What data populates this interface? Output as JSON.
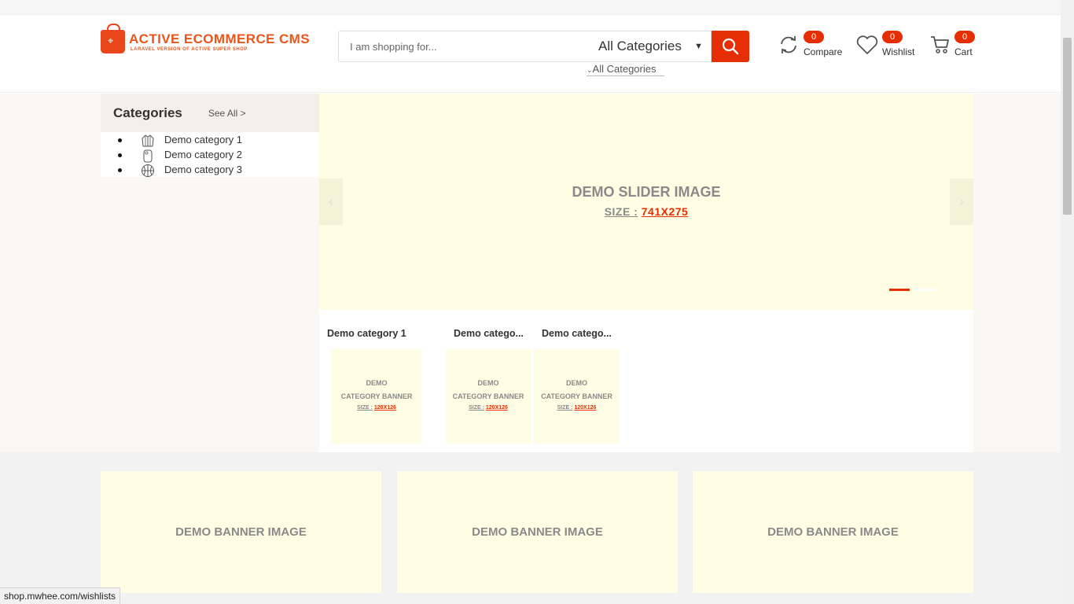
{
  "logo": {
    "title": "ACTIVE ECOMMERCE CMS",
    "tagline": "LARAVEL VERSION OF ACTIVE SUPER SHOP"
  },
  "search": {
    "placeholder": "I am shopping for...",
    "category_selected": "All Categories",
    "dropdown_option": "All Categories"
  },
  "header": {
    "compare": {
      "label": "Compare",
      "count": "0"
    },
    "wishlist": {
      "label": "Wishlist",
      "count": "0"
    },
    "cart": {
      "label": "Cart",
      "count": "0"
    }
  },
  "categories": {
    "heading": "Categories",
    "see_all": "See All >",
    "items": [
      {
        "label": "Demo category 1",
        "icon": "jacket-icon"
      },
      {
        "label": "Demo category 2",
        "icon": "phone-case-icon"
      },
      {
        "label": "Demo category 3",
        "icon": "basketball-icon"
      }
    ]
  },
  "slider": {
    "title": "DEMO SLIDER IMAGE",
    "size_label": "SIZE :",
    "size_value": "741X275",
    "dots": {
      "count": 2,
      "active_index": 0
    }
  },
  "category_banners": [
    {
      "title": "Demo category 1",
      "line1": "DEMO",
      "line2": "CATEGORY BANNER",
      "size_label": "SIZE :",
      "size_value": "120X126"
    },
    {
      "title": "Demo catego...",
      "line1": "DEMO",
      "line2": "CATEGORY BANNER",
      "size_label": "SIZE :",
      "size_value": "120X126"
    },
    {
      "title": "Demo catego...",
      "line1": "DEMO",
      "line2": "CATEGORY BANNER",
      "size_label": "SIZE :",
      "size_value": "120X126"
    }
  ],
  "banners": [
    "DEMO BANNER IMAGE",
    "DEMO BANNER IMAGE",
    "DEMO BANNER IMAGE"
  ],
  "status_bar": {
    "url": "shop.mwhee.com/wishlists"
  },
  "colors": {
    "accent": "#e62e04",
    "brand": "#e8561b",
    "placeholder_bg": "#fffde4",
    "active_dot": "#e62e04",
    "inactive_dot": "#ffffff"
  }
}
